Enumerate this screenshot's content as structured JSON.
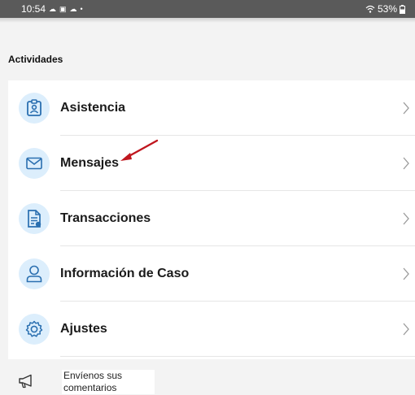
{
  "status_bar": {
    "time": "10:54",
    "battery": "53%"
  },
  "section_title": "Actividades",
  "menu": {
    "items": [
      {
        "label": "Asistencia",
        "icon": "badge-icon"
      },
      {
        "label": "Mensajes",
        "icon": "envelope-icon"
      },
      {
        "label": "Transacciones",
        "icon": "document-icon"
      },
      {
        "label": "Información de Caso",
        "icon": "person-icon"
      },
      {
        "label": "Ajustes",
        "icon": "gear-icon"
      }
    ]
  },
  "feedback": {
    "line1": "Envíenos sus",
    "line2": "comentarios",
    "icon": "megaphone-icon"
  },
  "colors": {
    "icon_accent": "#2a6fb0",
    "icon_bg": "#dceefc",
    "annotation_arrow": "#c0161e"
  }
}
